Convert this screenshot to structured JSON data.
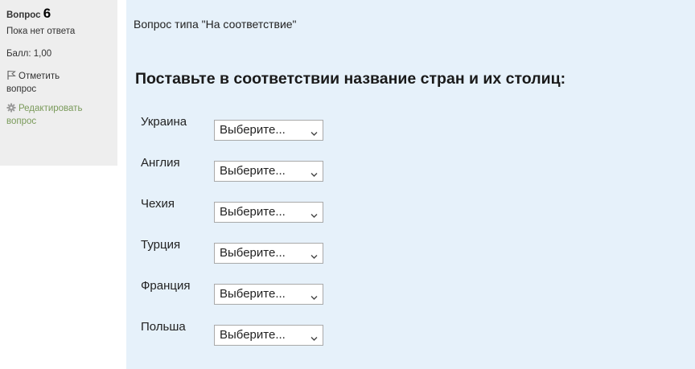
{
  "info": {
    "question_word": "Вопрос",
    "question_number": "6",
    "status": "Пока нет ответа",
    "score": "Балл: 1,00",
    "flag_label_line1": "Отметить",
    "flag_label_line2": "вопрос",
    "edit_label_line1": "Редактировать",
    "edit_label_line2": "вопрос",
    "flag_icon": "flag-icon",
    "edit_icon": "gear-icon"
  },
  "content": {
    "question_type": "Вопрос типа \"На соответствие\"",
    "prompt": "Поставьте в соответствии название стран и их столиц:",
    "select_placeholder": "Выберите...",
    "rows": [
      {
        "country": "Украина",
        "selected": "Выберите..."
      },
      {
        "country": "Англия",
        "selected": "Выберите..."
      },
      {
        "country": "Чехия",
        "selected": "Выберите..."
      },
      {
        "country": "Турция",
        "selected": "Выберите..."
      },
      {
        "country": "Франция",
        "selected": "Выберите..."
      },
      {
        "country": "Польша",
        "selected": "Выберите..."
      }
    ]
  },
  "colors": {
    "info_background": "#eeeeee",
    "content_background": "#e6f1fa",
    "edit_link": "#7a9a5a"
  }
}
